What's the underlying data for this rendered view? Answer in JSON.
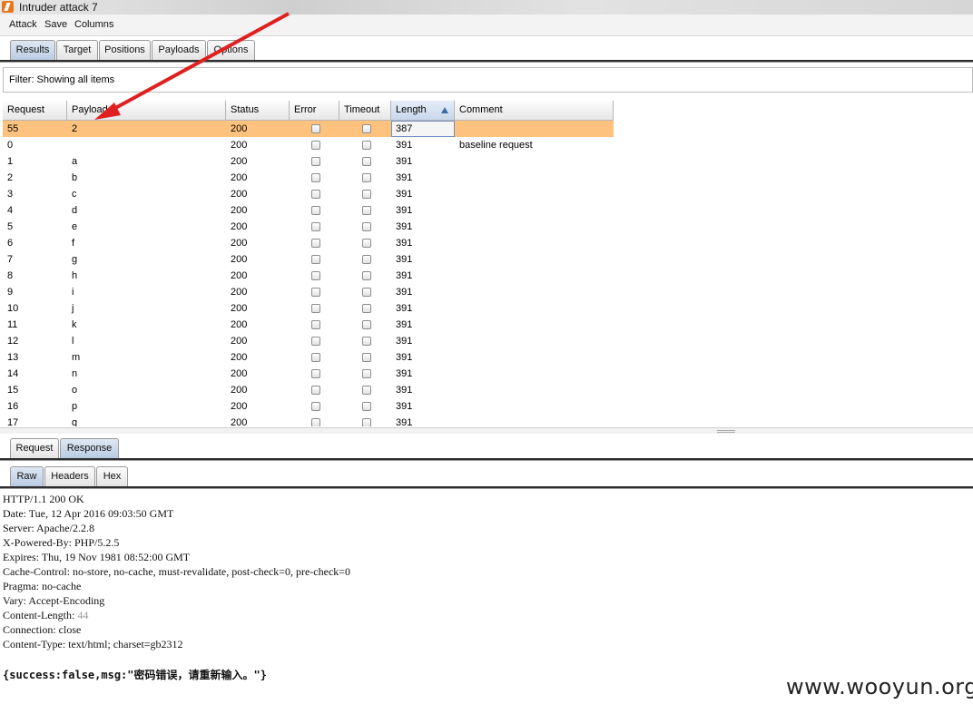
{
  "window": {
    "title": "Intruder attack 7"
  },
  "menu": [
    "Attack",
    "Save",
    "Columns"
  ],
  "tabs": {
    "main": [
      "Results",
      "Target",
      "Positions",
      "Payloads",
      "Options"
    ],
    "main_active": "Results",
    "viewer": [
      "Request",
      "Response"
    ],
    "viewer_active": "Response",
    "format": [
      "Raw",
      "Headers",
      "Hex"
    ],
    "format_active": "Raw"
  },
  "filter": {
    "text": "Filter: Showing all items"
  },
  "table": {
    "columns": [
      "Request",
      "Payload",
      "Status",
      "Error",
      "Timeout",
      "Length",
      "Comment"
    ],
    "sorted_column": "Length",
    "rows": [
      {
        "request": "55",
        "payload": "2",
        "status": "200",
        "length": "387",
        "comment": "",
        "selected": true
      },
      {
        "request": "0",
        "payload": "",
        "status": "200",
        "length": "391",
        "comment": "baseline request"
      },
      {
        "request": "1",
        "payload": "a",
        "status": "200",
        "length": "391",
        "comment": ""
      },
      {
        "request": "2",
        "payload": "b",
        "status": "200",
        "length": "391",
        "comment": ""
      },
      {
        "request": "3",
        "payload": "c",
        "status": "200",
        "length": "391",
        "comment": ""
      },
      {
        "request": "4",
        "payload": "d",
        "status": "200",
        "length": "391",
        "comment": ""
      },
      {
        "request": "5",
        "payload": "e",
        "status": "200",
        "length": "391",
        "comment": ""
      },
      {
        "request": "6",
        "payload": "f",
        "status": "200",
        "length": "391",
        "comment": ""
      },
      {
        "request": "7",
        "payload": "g",
        "status": "200",
        "length": "391",
        "comment": ""
      },
      {
        "request": "8",
        "payload": "h",
        "status": "200",
        "length": "391",
        "comment": ""
      },
      {
        "request": "9",
        "payload": "i",
        "status": "200",
        "length": "391",
        "comment": ""
      },
      {
        "request": "10",
        "payload": "j",
        "status": "200",
        "length": "391",
        "comment": ""
      },
      {
        "request": "11",
        "payload": "k",
        "status": "200",
        "length": "391",
        "comment": ""
      },
      {
        "request": "12",
        "payload": "l",
        "status": "200",
        "length": "391",
        "comment": ""
      },
      {
        "request": "13",
        "payload": "m",
        "status": "200",
        "length": "391",
        "comment": ""
      },
      {
        "request": "14",
        "payload": "n",
        "status": "200",
        "length": "391",
        "comment": ""
      },
      {
        "request": "15",
        "payload": "o",
        "status": "200",
        "length": "391",
        "comment": ""
      },
      {
        "request": "16",
        "payload": "p",
        "status": "200",
        "length": "391",
        "comment": ""
      },
      {
        "request": "17",
        "payload": "q",
        "status": "200",
        "length": "391",
        "comment": ""
      }
    ]
  },
  "response": {
    "headers": [
      "HTTP/1.1 200 OK",
      "Date: Tue, 12 Apr 2016 09:03:50 GMT",
      "Server: Apache/2.2.8",
      "X-Powered-By: PHP/5.2.5",
      "Expires: Thu, 19 Nov 1981 08:52:00 GMT",
      "Cache-Control: no-store, no-cache, must-revalidate, post-check=0, pre-check=0",
      "Pragma: no-cache",
      "Vary: Accept-Encoding",
      "Content-Length: ",
      "Connection: close",
      "Content-Type: text/html; charset=gb2312"
    ],
    "content_length_value": "44",
    "body": "{success:false,msg:\"密码错误，请重新输入。\"}"
  },
  "watermark": "www.wooyun.org",
  "colors": {
    "selected_row": "#fdc37e",
    "arrow": "#e02020"
  }
}
